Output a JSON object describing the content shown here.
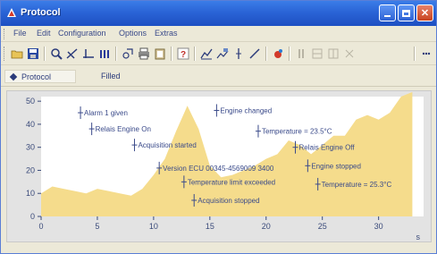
{
  "window": {
    "title": "Protocol"
  },
  "titlebar_buttons": [
    "minimize",
    "maximize",
    "close"
  ],
  "menu": [
    "File",
    "Edit",
    "Configuration",
    "Options",
    "Extras"
  ],
  "toolbar_icons": [
    "open-folder-icon",
    "save-icon",
    "zoom-icon",
    "measure-icon",
    "cursor-line-icon",
    "bars-icon",
    "copy-icon",
    "print-icon",
    "clipboard-icon",
    "help-icon",
    "chart-icon",
    "chart-settings-icon",
    "marker-icon",
    "line-icon",
    "color-icon",
    "pause-icon",
    "grid-icon",
    "filter-icon",
    "more-icon"
  ],
  "tabs": [
    {
      "label": "Protocol",
      "active": true
    },
    {
      "label": "Filled",
      "active": false
    }
  ],
  "chart_data": {
    "type": "area",
    "x": [
      0,
      1,
      2,
      3,
      4,
      5,
      6,
      7,
      8,
      9,
      10,
      11,
      12,
      13,
      14,
      15,
      16,
      17,
      18,
      19,
      20,
      21,
      22,
      23,
      24,
      25,
      26,
      27,
      28,
      29,
      30,
      31,
      32,
      33
    ],
    "values": [
      10,
      13,
      12,
      11,
      10,
      12,
      11,
      10,
      9,
      12,
      18,
      25,
      37,
      48,
      38,
      22,
      17,
      18,
      20,
      22,
      25,
      27,
      33,
      31,
      27,
      31,
      35,
      35,
      42,
      44,
      42,
      45,
      52,
      54
    ],
    "xlim": [
      0,
      34
    ],
    "ylim": [
      0,
      52
    ],
    "xticks": [
      0,
      5,
      10,
      15,
      20,
      25,
      30
    ],
    "yticks": [
      0,
      10,
      20,
      30,
      40,
      50
    ],
    "xlabel": "s",
    "fill_color": "#f5dc8c",
    "events": [
      {
        "x": 3.5,
        "y": 45,
        "label": "Alarm 1 given"
      },
      {
        "x": 4.5,
        "y": 38,
        "label": "Relais Engine On"
      },
      {
        "x": 8.3,
        "y": 31,
        "label": "Acquisition started"
      },
      {
        "x": 10.5,
        "y": 21,
        "label": "Version ECU 00345-4569009 3400"
      },
      {
        "x": 12.7,
        "y": 15,
        "label": "Temperature limit exceeded"
      },
      {
        "x": 13.6,
        "y": 7,
        "label": "Acquisition stopped"
      },
      {
        "x": 15.6,
        "y": 46,
        "label": "Engine changed"
      },
      {
        "x": 19.3,
        "y": 37,
        "label": "Temperature = 23.5°C"
      },
      {
        "x": 22.6,
        "y": 30,
        "label": "Relais Engine Off"
      },
      {
        "x": 23.7,
        "y": 22,
        "label": "Engine stopped"
      },
      {
        "x": 24.6,
        "y": 14,
        "label": "Temperature = 25.3°C"
      }
    ]
  }
}
